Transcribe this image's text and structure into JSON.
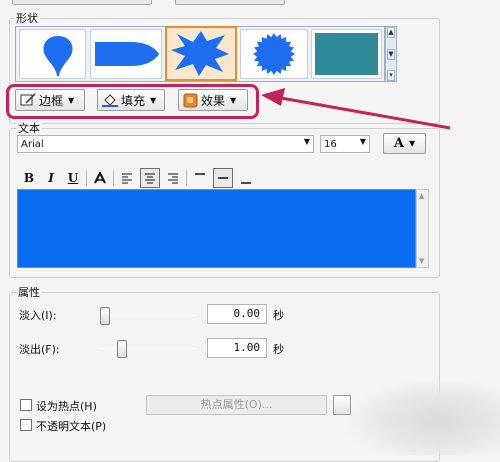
{
  "shape_section": {
    "label": "形状",
    "shapes": [
      {
        "name": "teardrop-pin-shape"
      },
      {
        "name": "bullet-shape"
      },
      {
        "name": "explosion-burst-shape",
        "selected": true
      },
      {
        "name": "sunburst-circle-shape"
      },
      {
        "name": "square-shape"
      }
    ],
    "shape_color": "#1f6df0",
    "square_color": "#2e8a96",
    "border_button": "边框",
    "fill_button": "填充",
    "effect_button": "效果"
  },
  "text_section": {
    "label": "文本",
    "font_name": "Arial",
    "font_size": "16",
    "color_button": "A",
    "bold": "B",
    "italic": "I",
    "underline": "U",
    "text_bg_color": "#0a6cf0"
  },
  "properties_section": {
    "label": "属性",
    "fade_in_label": "淡入(I):",
    "fade_in_value": "0.00",
    "fade_in_unit": "秒",
    "fade_in_level": 0,
    "fade_out_label": "淡出(F):",
    "fade_out_value": "1.00",
    "fade_out_unit": "秒",
    "fade_out_level": 0.2,
    "hotspot_checkbox": "设为热点(H)",
    "hotspot_props_button": "热点属性(O)...",
    "opaque_text_checkbox": "不透明文本(P)"
  },
  "annotation_color": "#c0245c"
}
